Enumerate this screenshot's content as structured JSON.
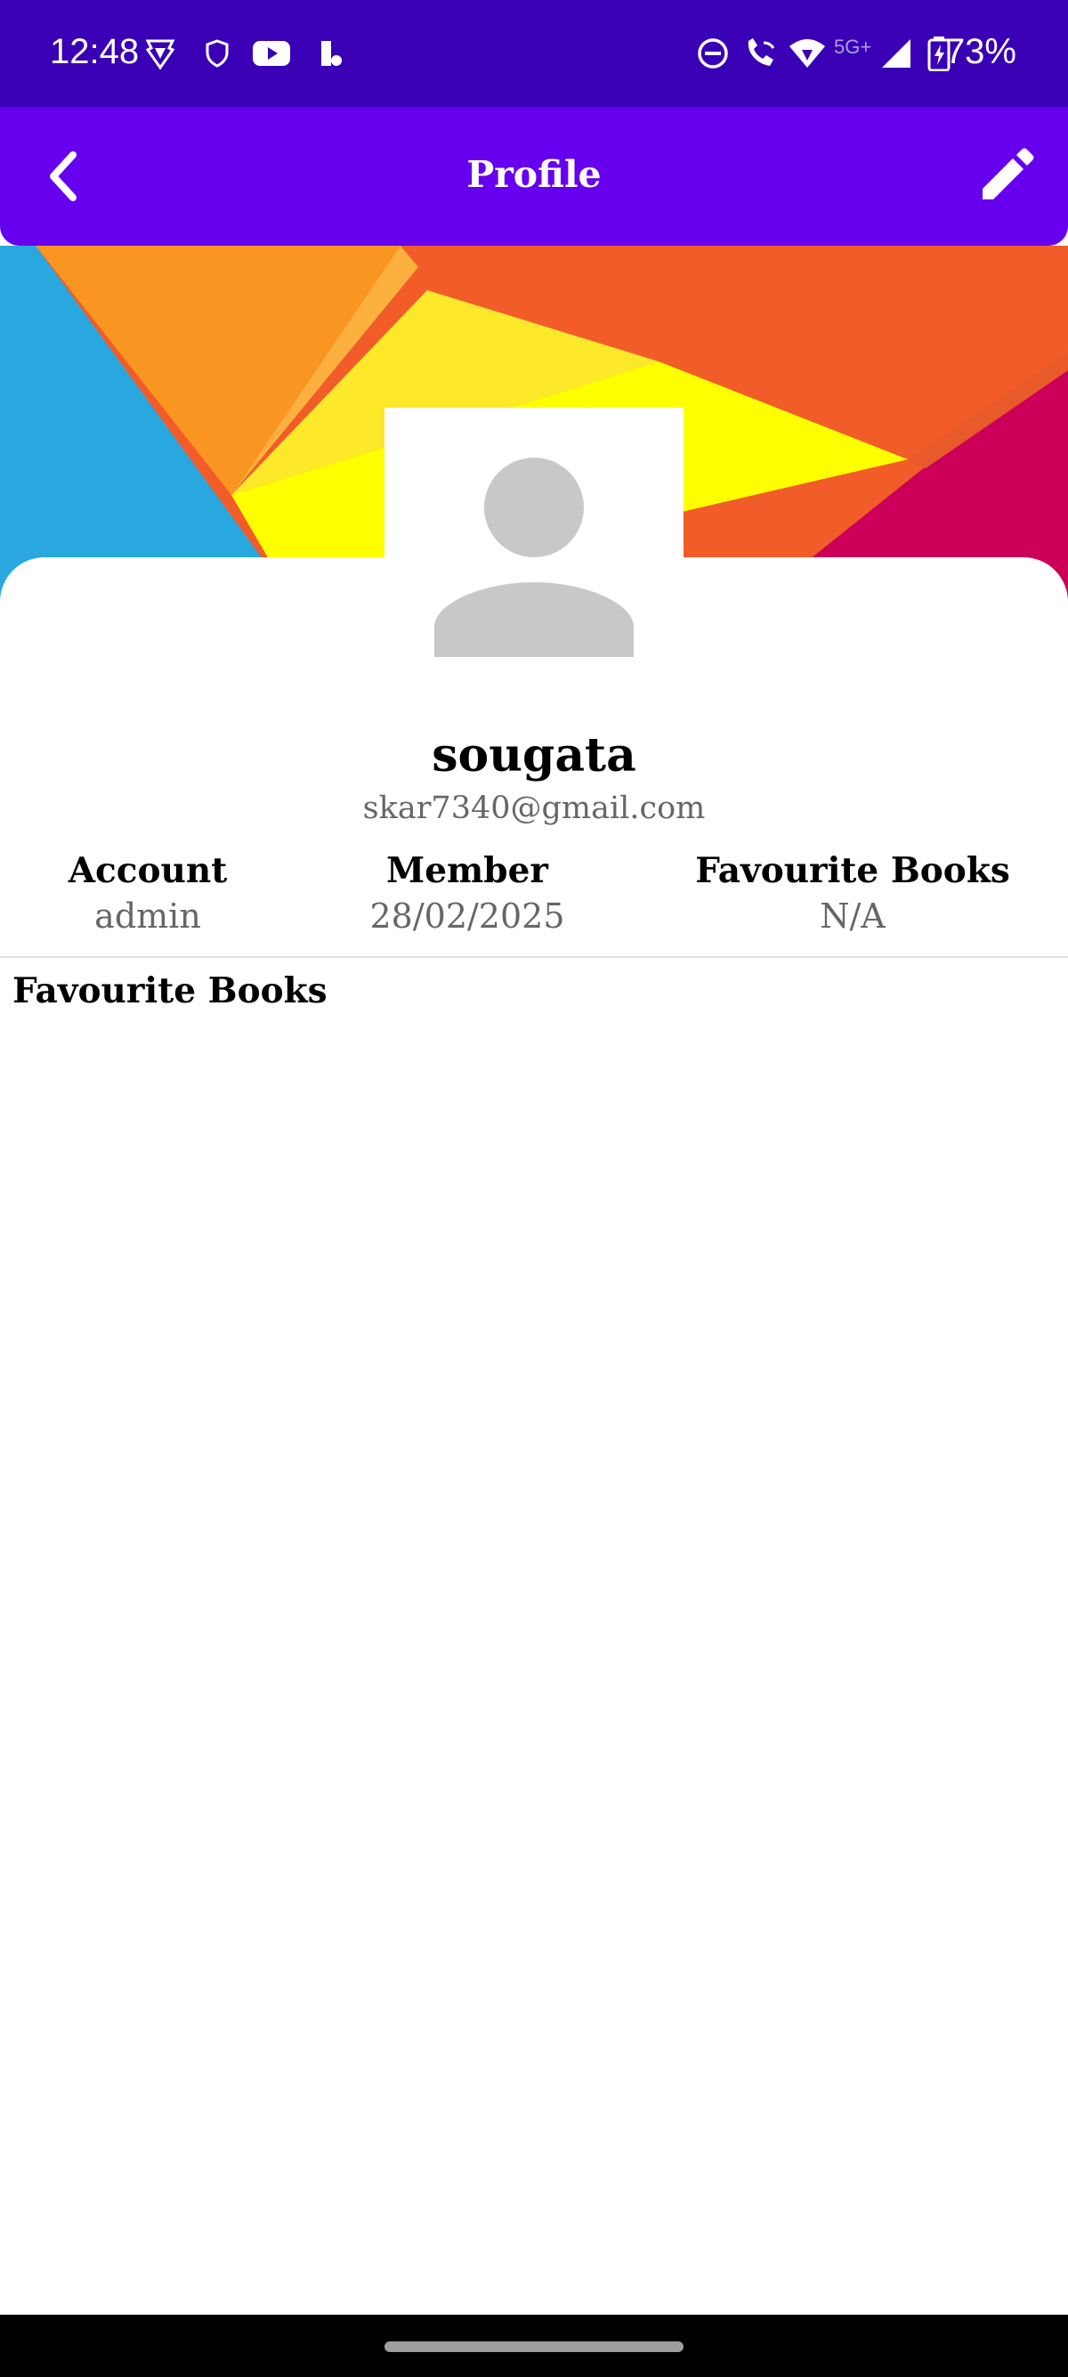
{
  "status_bar": {
    "time": "12:48",
    "network_label": "5G+",
    "battery_percent": "73%",
    "icons": [
      "brave-shield-icon",
      "vpn-shield-icon",
      "youtube-icon",
      "battery-saver-icon",
      "do-not-disturb-icon",
      "wifi-calling-icon",
      "wifi-icon",
      "signal-icon",
      "battery-charging-icon"
    ]
  },
  "app_bar": {
    "title": "Profile",
    "background": "#6600ee"
  },
  "profile": {
    "name": "sougata",
    "email": "skar7340@gmail.com"
  },
  "stats": [
    {
      "label": "Account",
      "value": "admin"
    },
    {
      "label": "Member",
      "value": "28/02/2025"
    },
    {
      "label": "Favourite Books",
      "value": "N/A"
    }
  ],
  "sections": {
    "favourite_books_title": "Favourite Books"
  },
  "colors": {
    "status_bar": "#3900b5",
    "accent": "#6600ee",
    "muted_text": "#666666"
  }
}
